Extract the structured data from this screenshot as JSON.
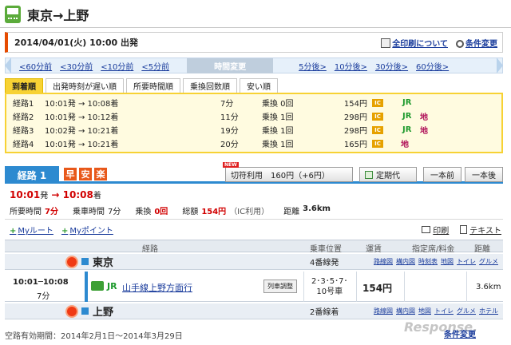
{
  "header": {
    "title": "東京→上野"
  },
  "condition": {
    "datetime": "2014/04/01(火)  10:00  出発",
    "print_all": "全印刷について",
    "change_cond": "条件変更"
  },
  "time_nav": {
    "prev": [
      "<60分前",
      "<30分前",
      "<10分前",
      "<5分前"
    ],
    "center": "時間変更",
    "next": [
      "5分後>",
      "10分後>",
      "30分後>",
      "60分後>"
    ]
  },
  "sort_tabs": [
    "到着順",
    "出発時刻が遅い順",
    "所要時間順",
    "乗換回数順",
    "安い順"
  ],
  "routes": [
    {
      "name": "経路1",
      "time": "10:01発 → 10:08着",
      "dur": "7分",
      "transfer": "乗換 0回",
      "fare": "154円",
      "ic": "IC",
      "jr": "JR",
      "chi": ""
    },
    {
      "name": "経路2",
      "time": "10:01発 → 10:12着",
      "dur": "11分",
      "transfer": "乗換 1回",
      "fare": "298円",
      "ic": "IC",
      "jr": "JR",
      "chi": "地"
    },
    {
      "name": "経路3",
      "time": "10:02発 → 10:21着",
      "dur": "19分",
      "transfer": "乗換 1回",
      "fare": "298円",
      "ic": "IC",
      "jr": "JR",
      "chi": "地"
    },
    {
      "name": "経路4",
      "time": "10:01発 → 10:21着",
      "dur": "20分",
      "transfer": "乗換 1回",
      "fare": "165円",
      "ic": "IC",
      "jr": "",
      "chi": "地"
    }
  ],
  "route_tab": {
    "label": "経路 1",
    "badges": [
      "早",
      "安",
      "楽"
    ],
    "new": "NEW",
    "ticket": "切符利用　160円（+6円）",
    "teiki": "定期代",
    "prev_btn": "一本前",
    "next_btn": "一本後"
  },
  "summary": {
    "dep": "10:01",
    "dep_suffix": "発",
    "arrow": "→",
    "arr": "10:08",
    "arr_suffix": "着",
    "total_label": "所要時間",
    "total": "7分",
    "ride_label": "乗車時間",
    "ride": "7分",
    "transfer_label": "乗換",
    "transfer": "0回",
    "fare_label": "総額",
    "fare": "154円",
    "fare_note": "（IC利用）",
    "dist_label": "距離",
    "dist": "3.6km"
  },
  "links": {
    "my_route": "Myルート",
    "my_point": "Myポイント",
    "print": "印刷",
    "text": "テキスト"
  },
  "detail_head": {
    "route": "経路",
    "position": "乗車位置",
    "fare": "運賃",
    "reserved": "指定席/料金",
    "dist": "距離"
  },
  "departure": {
    "name": "東京",
    "platform": "4番線発",
    "links": [
      "路線図",
      "構内図",
      "時刻表",
      "地図",
      "トイレ",
      "グルメ"
    ]
  },
  "segment": {
    "time": "10:01─10:08",
    "dur": "7分",
    "operator": "JR",
    "line": "山手線上野方面行",
    "adjust": "列車調整",
    "cars_line1": "2･3･5･7･",
    "cars_line2": "10号車",
    "fare": "154円",
    "dist": "3.6km"
  },
  "arrival": {
    "name": "上野",
    "platform": "2番線着",
    "links": [
      "路線図",
      "構内図",
      "地図",
      "トイレ",
      "グルメ",
      "ホテル"
    ]
  },
  "validity": "空路有効期間：2014年2月1日〜2014年3月29日",
  "footer_link": "条件変更",
  "watermark": "Response."
}
